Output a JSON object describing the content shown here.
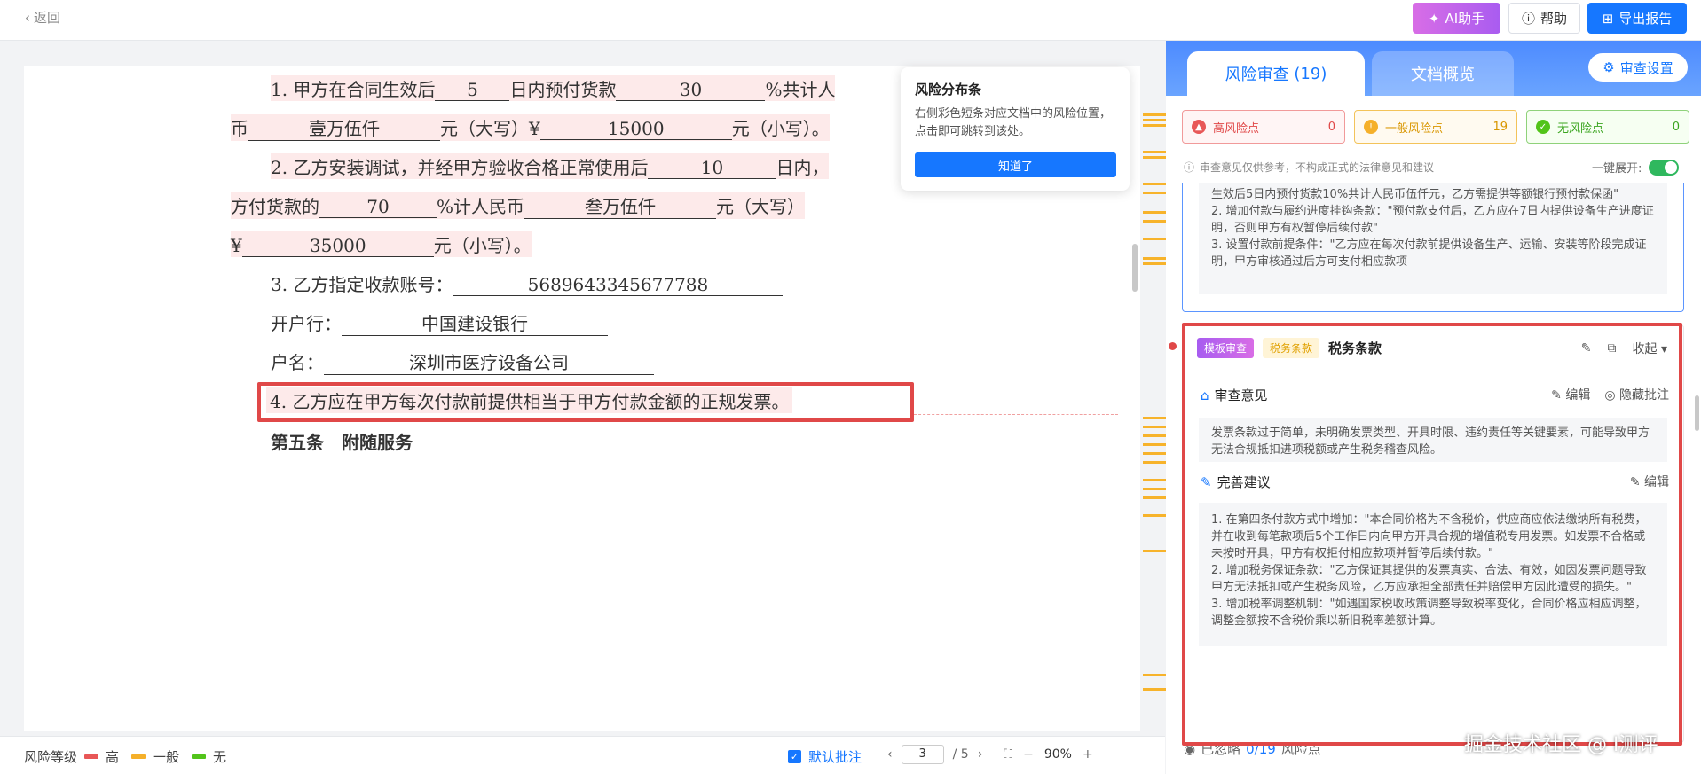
{
  "topbar": {
    "back": "返回",
    "ai_button": "AI助手",
    "help_button": "帮助",
    "export_button": "导出报告"
  },
  "document": {
    "l1": {
      "a": "1. 甲方在合同生效后",
      "b": "5",
      "c": "日内预付货款",
      "d": "30",
      "e": "%共计人"
    },
    "l2": {
      "a": "币",
      "b": "壹万伍仟",
      "c": "元（大写）¥",
      "d": "15000",
      "e": "元（小写）。"
    },
    "l3": {
      "a": "2. 乙方安装调试，并经甲方验收合格正常使用后",
      "b": "10",
      "c": "日内，"
    },
    "l4": {
      "a": "方付货款的",
      "b": "70",
      "c": "%计人民币",
      "d": "叁万伍仟",
      "e": "元（大写）"
    },
    "l5": {
      "a": "¥",
      "b": "35000",
      "c": "元（小写）。"
    },
    "l6": {
      "a": "3. 乙方指定收款账号：",
      "b": "5689643345677788"
    },
    "l7": {
      "a": "开户行：",
      "b": "中国建设银行"
    },
    "l8": {
      "a": "户名：",
      "b": "深圳市医疗设备公司"
    },
    "l9": "4. 乙方应在甲方每次付款前提供相当于甲方付款金额的正规发票。",
    "l10": "第五条　附随服务"
  },
  "popover": {
    "title": "风险分布条",
    "text": "右侧彩色短条对应文档中的风险位置，点击即可跳转到该处。",
    "button": "知道了"
  },
  "bottombar": {
    "legend_label": "风险等级",
    "legend_high": "高",
    "legend_mid": "一般",
    "legend_none": "无",
    "default_annotation": "默认批注",
    "page_current": "3",
    "page_total": "/ 5",
    "zoom": "90%",
    "colors": {
      "high": "#e85757",
      "mid": "#f5b02a",
      "none": "#52c41a"
    }
  },
  "panel": {
    "tab_review": "风险审查",
    "tab_review_count": "(19)",
    "tab_overview": "文档概览",
    "review_settings": "审查设置",
    "risk_high_label": "高风险点",
    "risk_high_count": "0",
    "risk_mid_label": "一般风险点",
    "risk_mid_count": "19",
    "risk_none_label": "无风险点",
    "risk_none_count": "0",
    "disclaimer": "审查意见仅供参考，不构成正式的法律意见和建议",
    "expand_all": "一键展开:",
    "card1_text": "生效后5日内预付货款10%共计人民币伍仟元，乙方需提供等额银行预付款保函\"\n2. 增加付款与履约进度挂钩条款：\"预付款支付后，乙方应在7日内提供设备生产进度证明，否则甲方有权暂停后续付款\"\n3. 设置付款前提条件：\"乙方应在每次付款前提供设备生产、运输、安装等阶段完成证明，甲方审核通过后方可支付相应款项",
    "card2": {
      "tag_template": "模板审查",
      "tag_tax": "税务条款",
      "title": "税务条款",
      "collapse": "收起",
      "opinion_title": "审查意见",
      "edit": "编辑",
      "hide_annotation": "隐藏批注",
      "opinion_text": "发票条款过于简单，未明确发票类型、开具时限、违约责任等关键要素，可能导致甲方无法合规抵扣进项税额或产生税务稽查风险。",
      "suggestion_title": "完善建议",
      "suggestion_text": "1. 在第四条付款方式中增加：\"本合同价格为不含税价，供应商应依法缴纳所有税费，并在收到每笔款项后5个工作日内向甲方开具合规的增值税专用发票。如发票不合格或未按时开具，甲方有权拒付相应款项并暂停后续付款。\"\n2. 增加税务保证条款：\"乙方保证其提供的发票真实、合法、有效，如因发票问题导致甲方无法抵扣或产生税务风险，乙方应承担全部责任并赔偿甲方因此遭受的损失。\"\n3. 增加税率调整机制：\"如遇国家税收政策调整导致税率变化，合同价格应相应调整，调整金额按不含税价乘以新旧税率差额计算。"
    },
    "ignored_prefix": "已忽略",
    "ignored_count": "0/19",
    "ignored_suffix": "风险点"
  },
  "watermark": "掘金技术社区 @ I测评"
}
